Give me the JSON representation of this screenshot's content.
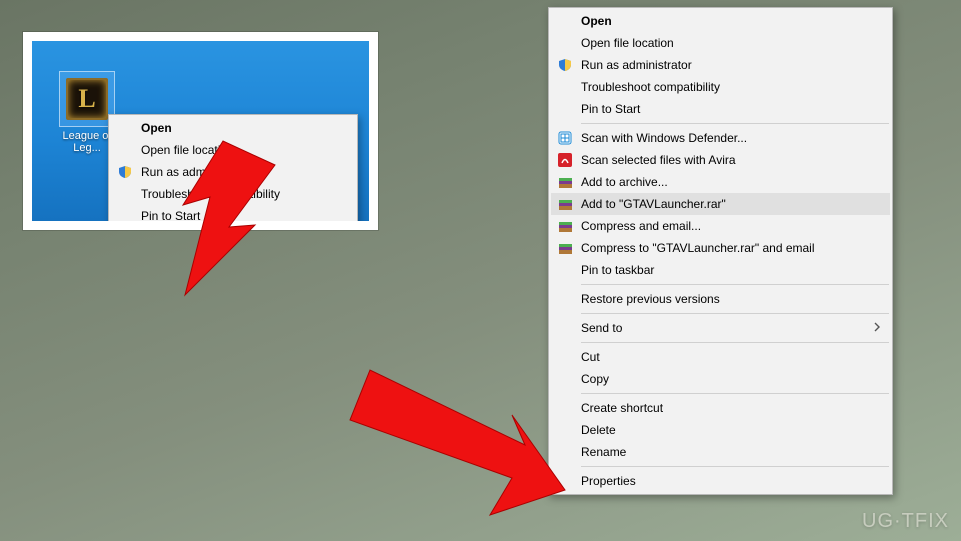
{
  "desktop_icon_label": "League of Leg...",
  "watermark": "UG·TFIX",
  "left_menu": {
    "open": "Open",
    "open_loc": "Open file location",
    "run_admin": "Run as administrator",
    "troubleshoot": "Troubleshoot compatibility",
    "pin_start": "Pin to Start"
  },
  "right_menu": {
    "open": "Open",
    "open_loc": "Open file location",
    "run_admin": "Run as administrator",
    "troubleshoot": "Troubleshoot compatibility",
    "pin_start": "Pin to Start",
    "scan_defender": "Scan with Windows Defender...",
    "scan_avira": "Scan selected files with Avira",
    "add_archive": "Add to archive...",
    "add_gtav": "Add to \"GTAVLauncher.rar\"",
    "compress_email": "Compress and email...",
    "compress_gtav_email": "Compress to \"GTAVLauncher.rar\" and email",
    "pin_taskbar": "Pin to taskbar",
    "restore": "Restore previous versions",
    "send_to": "Send to",
    "cut": "Cut",
    "copy": "Copy",
    "create_shortcut": "Create shortcut",
    "delete": "Delete",
    "rename": "Rename",
    "properties": "Properties"
  }
}
